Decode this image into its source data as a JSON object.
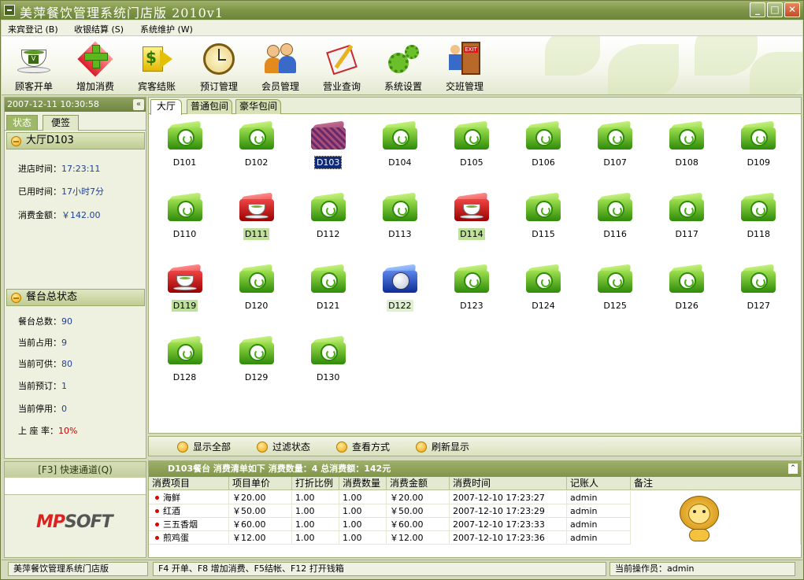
{
  "window": {
    "title": "美萍餐饮管理系统门店版 2010v1",
    "min": "_",
    "max": "□",
    "close": "✕"
  },
  "menu": [
    {
      "label": "来宾登记 (B)"
    },
    {
      "label": "收银结算 (S)"
    },
    {
      "label": "系统维护 (W)"
    }
  ],
  "toolbar": {
    "items": [
      {
        "label": "顾客开单",
        "icon": "tea-cup-icon"
      },
      {
        "label": "增加消费",
        "icon": "add-consumption-icon"
      },
      {
        "label": "宾客结账",
        "icon": "checkout-icon"
      },
      {
        "label": "预订管理",
        "icon": "clock-icon"
      },
      {
        "label": "会员管理",
        "icon": "members-icon"
      },
      {
        "label": "营业查询",
        "icon": "notebook-icon"
      },
      {
        "label": "系统设置",
        "icon": "gears-icon"
      },
      {
        "label": "交班管理",
        "icon": "exit-icon"
      }
    ]
  },
  "left": {
    "datetime": "2007-12-11 10:30:58",
    "collapse": "«",
    "tabs": [
      {
        "label": "状态",
        "active": true
      },
      {
        "label": "便签",
        "active": false
      }
    ],
    "table_section": {
      "title": "大厅D103",
      "fields": [
        {
          "label": "进店时间：",
          "value": "17:23:11"
        },
        {
          "label": "已用时间：",
          "value": "17小时7分"
        },
        {
          "label": "消费金额：",
          "value": "￥142.00"
        }
      ]
    },
    "summary_section": {
      "title": "餐台总状态",
      "fields": [
        {
          "label": "餐台总数：",
          "value": "90"
        },
        {
          "label": "当前占用：",
          "value": "9"
        },
        {
          "label": "当前可供：",
          "value": "80"
        },
        {
          "label": "当前预订：",
          "value": "1"
        },
        {
          "label": "当前停用：",
          "value": "0"
        },
        {
          "label": "上 座 率：",
          "value": "10%"
        }
      ]
    },
    "quick": {
      "title": "[F3] 快速通道(Q)"
    },
    "logo": {
      "part1": "MP",
      "part2": "SOFT"
    }
  },
  "main": {
    "tabs": [
      {
        "label": "大厅",
        "active": true
      },
      {
        "label": "普通包间",
        "active": false
      },
      {
        "label": "豪华包间",
        "active": false
      }
    ],
    "tables": [
      {
        "name": "D101",
        "status": "free"
      },
      {
        "name": "D102",
        "status": "free"
      },
      {
        "name": "D103",
        "status": "selected"
      },
      {
        "name": "D104",
        "status": "free"
      },
      {
        "name": "D105",
        "status": "free"
      },
      {
        "name": "D106",
        "status": "free"
      },
      {
        "name": "D107",
        "status": "free"
      },
      {
        "name": "D108",
        "status": "free"
      },
      {
        "name": "D109",
        "status": "free"
      },
      {
        "name": "D110",
        "status": "free"
      },
      {
        "name": "D111",
        "status": "occupied"
      },
      {
        "name": "D112",
        "status": "free"
      },
      {
        "name": "D113",
        "status": "free"
      },
      {
        "name": "D114",
        "status": "occupied"
      },
      {
        "name": "D115",
        "status": "free"
      },
      {
        "name": "D116",
        "status": "free"
      },
      {
        "name": "D117",
        "status": "free"
      },
      {
        "name": "D118",
        "status": "free"
      },
      {
        "name": "D119",
        "status": "occupied"
      },
      {
        "name": "D120",
        "status": "free"
      },
      {
        "name": "D121",
        "status": "free"
      },
      {
        "name": "D122",
        "status": "reserved"
      },
      {
        "name": "D123",
        "status": "free"
      },
      {
        "name": "D124",
        "status": "free"
      },
      {
        "name": "D125",
        "status": "free"
      },
      {
        "name": "D126",
        "status": "free"
      },
      {
        "name": "D127",
        "status": "free"
      },
      {
        "name": "D128",
        "status": "free"
      },
      {
        "name": "D129",
        "status": "free"
      },
      {
        "name": "D130",
        "status": "free"
      }
    ]
  },
  "filters": [
    {
      "label": "显示全部"
    },
    {
      "label": "过滤状态"
    },
    {
      "label": "查看方式"
    },
    {
      "label": "刷新显示"
    }
  ],
  "detail": {
    "header": "D103餐台  消费清单如下 消费数量：4 总消费额：142元",
    "columns": [
      "消费项目",
      "项目单价",
      "打折比例",
      "消费数量",
      "消费金额",
      "消费时间",
      "记账人",
      "备注"
    ],
    "rows": [
      [
        "海鲜",
        "￥20.00",
        "1.00",
        "1.00",
        "￥20.00",
        "2007-12-10 17:23:27",
        "admin",
        ""
      ],
      [
        "红酒",
        "￥50.00",
        "1.00",
        "1.00",
        "￥50.00",
        "2007-12-10 17:23:29",
        "admin",
        ""
      ],
      [
        "三五香烟",
        "￥60.00",
        "1.00",
        "1.00",
        "￥60.00",
        "2007-12-10 17:23:33",
        "admin",
        ""
      ],
      [
        "煎鸡蛋",
        "￥12.00",
        "1.00",
        "1.00",
        "￥12.00",
        "2007-12-10 17:23:36",
        "admin",
        ""
      ]
    ]
  },
  "status": {
    "app": "美萍餐饮管理系统门店版",
    "hint": "F4 开单、F8 增加消费、F5结帐、F12 打开钱箱",
    "operator": "当前操作员：admin"
  }
}
